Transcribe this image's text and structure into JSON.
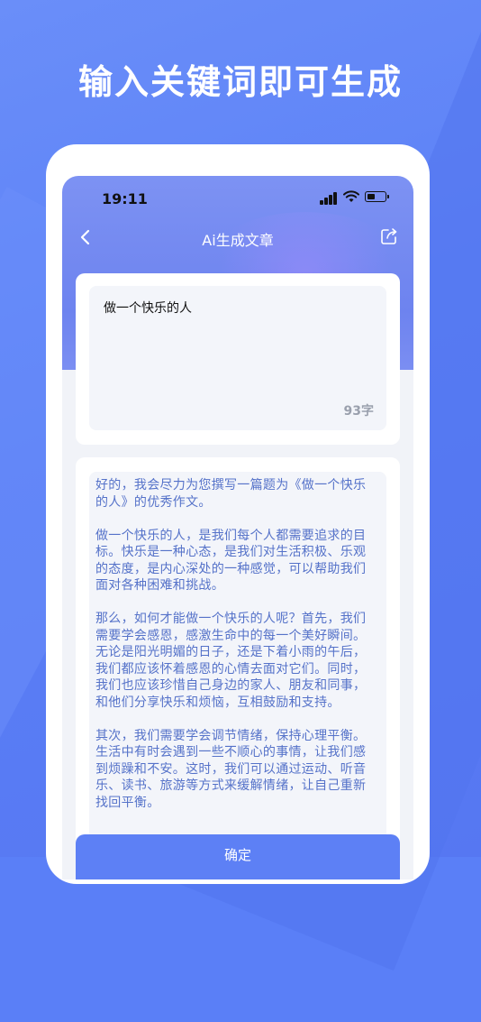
{
  "headline": "输入关键词即可生成",
  "status": {
    "time": "19:11"
  },
  "nav": {
    "title": "Ai生成文章"
  },
  "input": {
    "value": "做一个快乐的人",
    "char_count": "93字"
  },
  "output": {
    "paragraphs": [
      "好的，我会尽力为您撰写一篇题为《做一个快乐的人》的优秀作文。",
      "做一个快乐的人，是我们每个人都需要追求的目标。快乐是一种心态，是我们对生活积极、乐观的态度，是内心深处的一种感觉，可以帮助我们面对各种困难和挑战。",
      "那么，如何才能做一个快乐的人呢？首先，我们需要学会感恩，感激生命中的每一个美好瞬间。无论是阳光明媚的日子，还是下着小雨的午后，我们都应该怀着感恩的心情去面对它们。同时，我们也应该珍惜自己身边的家人、朋友和同事，和他们分享快乐和烦恼，互相鼓励和支持。",
      "其次，我们需要学会调节情绪，保持心理平衡。生活中有时会遇到一些不顺心的事情，让我们感到烦躁和不安。这时，我们可以通过运动、听音乐、读书、旅游等方式来缓解情绪，让自己重新找回平衡。"
    ]
  },
  "confirm_label": "确定"
}
